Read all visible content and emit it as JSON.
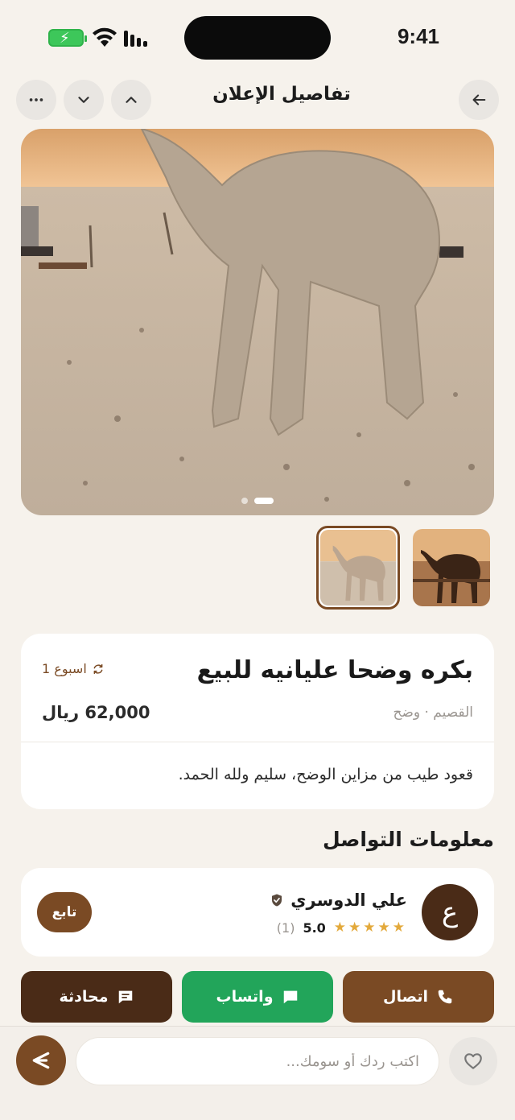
{
  "status_bar": {
    "time": "9:41"
  },
  "header": {
    "title": "تفاصيل الإعلان"
  },
  "gallery": {
    "slide_count": 2,
    "active_slide": 1
  },
  "listing": {
    "title": "بكره وضحا عليانيه للبيع",
    "age": "1 اسبوع",
    "location": "القصيم · وضح",
    "price": "62,000 ريال",
    "description": "قعود طيب من مزاين الوضح، سليم ولله الحمد."
  },
  "contact": {
    "section_title": "معلومات التواصل"
  },
  "seller": {
    "avatar_initial": "ع",
    "name": "علي الدوسري",
    "stars": "★★★★★",
    "rating": "5.0",
    "count": "(1)",
    "follow_label": "تابع"
  },
  "actions": {
    "chat_label": "محادثة",
    "whatsapp_label": "واتساب",
    "call_label": "اتصال"
  },
  "reply": {
    "placeholder": "اكتب ردك أو سومك..."
  },
  "colors": {
    "brand_brown": "#7a4a24",
    "dark_brown": "#4a2b17",
    "whatsapp_green": "#22a55a",
    "star_gold": "#e3a93b",
    "background": "#f6f2ec"
  }
}
